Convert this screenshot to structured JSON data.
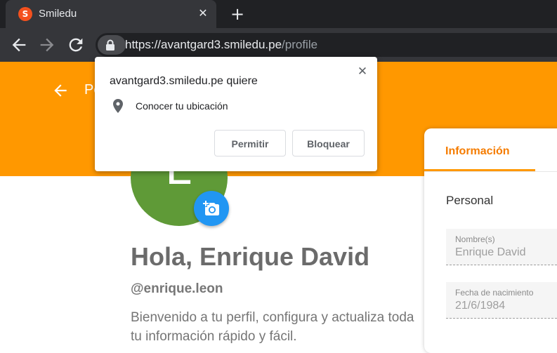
{
  "browser": {
    "tab": {
      "title": "Smiledu",
      "favicon_letter": "S",
      "favicon_color": "#f4511e"
    },
    "url": {
      "host": "https://avantgard3.smiledu.pe",
      "path": "/profile"
    },
    "icons": {
      "back": "back-arrow-icon",
      "forward": "forward-arrow-icon",
      "reload": "reload-icon",
      "lock": "lock-icon",
      "close": "close-icon",
      "new_tab": "plus-icon"
    }
  },
  "permission_dialog": {
    "title": "avantgard3.smiledu.pe quiere",
    "permission": "Conocer tu ubicación",
    "allow_label": "Permitir",
    "block_label": "Bloquear"
  },
  "header": {
    "title": "Pe",
    "color": "#ff9800"
  },
  "profile": {
    "avatar_letter": "E",
    "avatar_color": "#5f9a37",
    "greeting": "Hola, Enrique David",
    "username": "@enrique.leon",
    "welcome": "Bienvenido a tu perfil, configura y actualiza toda tu información rápido y fácil."
  },
  "info_card": {
    "tab_label": "Información",
    "section_title": "Personal",
    "fields": [
      {
        "label": "Nombre(s)",
        "value": "Enrique David"
      },
      {
        "label": "Fecha de nacimiento",
        "value": "21/6/1984"
      }
    ]
  }
}
